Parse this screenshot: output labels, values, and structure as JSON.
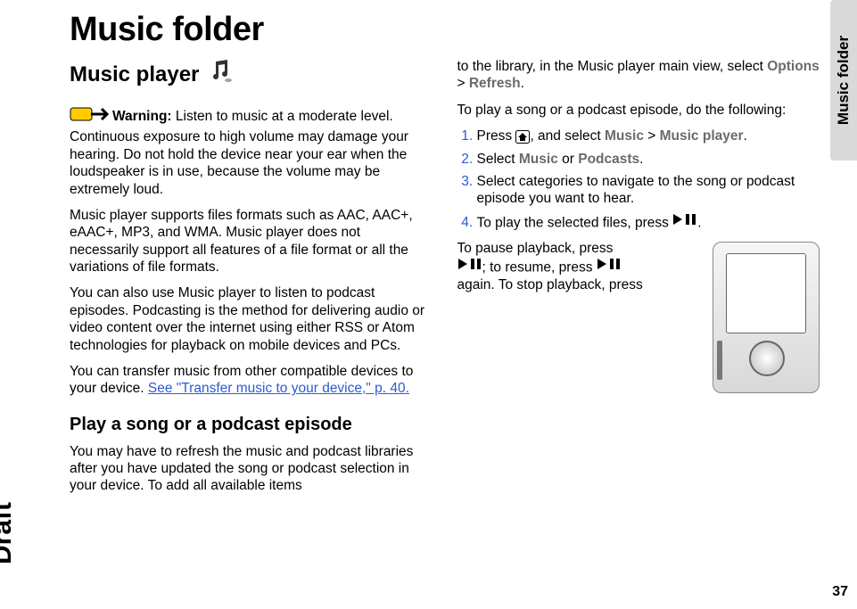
{
  "sideTab": "Music folder",
  "draft": "Draft",
  "pageNumber": "37",
  "title": "Music folder",
  "section": "Music player",
  "warningLabel": "Warning:",
  "warningText": "Listen to music at a moderate level. Continuous exposure to high volume may damage your hearing. Do not hold the device near your ear when the loudspeaker is in use, because the volume may be extremely loud.",
  "para1": "Music player supports files formats such as AAC, AAC+, eAAC+, MP3, and WMA. Music player does not necessarily support all features of a file format or all the variations of file formats.",
  "para2": "You can also use Music player to listen to podcast episodes. Podcasting is the method for delivering audio or video content over the internet using either RSS or Atom technologies for playback on mobile devices and PCs.",
  "para3a": "You can transfer music from other compatible devices to your device. ",
  "para3link": "See \"Transfer music to your device,\" p. 40.",
  "subsection": "Play a song or a podcast episode",
  "para4": "You may have to refresh the music and podcast libraries after you have updated the song or podcast selection in your device. To add all available items",
  "col2top_a": "to the library, in the Music player main view, select ",
  "menuOptions": "Options",
  "gt": " > ",
  "menuRefresh": "Refresh",
  "col2top_end": ".",
  "para5": "To play a song or a podcast episode, do the following:",
  "step1a": "Press ",
  "step1b": ", and select ",
  "menuMusic": "Music",
  "menuMusicPlayer": "Music player",
  "step1end": ".",
  "step2a": "Select ",
  "menuMusic2": "Music",
  "or": " or ",
  "menuPodcasts": "Podcasts",
  "step2end": ".",
  "step3": "Select categories to navigate to the song or podcast episode you want to hear.",
  "step4a": "To play the selected files, press ",
  "step4end": ".",
  "pauseA": "To pause playback, press ",
  "pauseB": "; to resume, press ",
  "pauseC": " again. To stop playback, press"
}
